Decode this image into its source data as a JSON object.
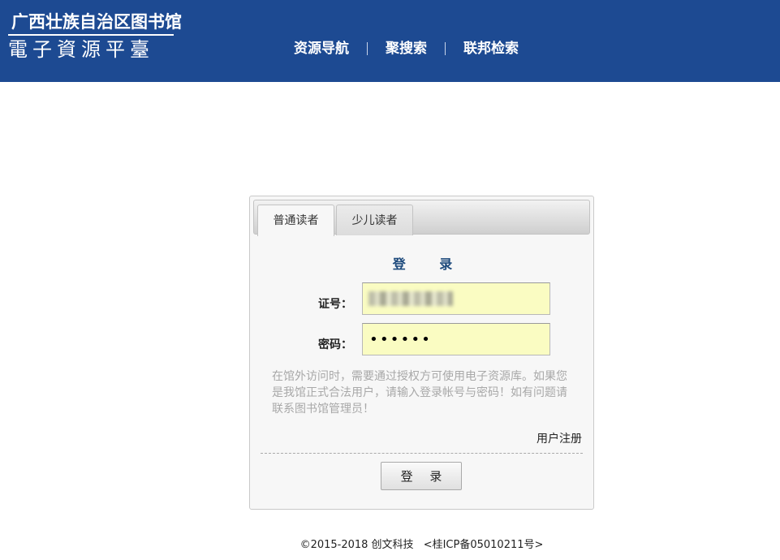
{
  "header": {
    "logo_line1": "广西壮族自治区图书馆",
    "logo_line2": "電子資源平臺",
    "nav": [
      "资源导航",
      "聚搜索",
      "联邦检索"
    ]
  },
  "login": {
    "tabs": [
      "普通读者",
      "少儿读者"
    ],
    "active_tab": 0,
    "title": "登 录",
    "card_label": "证号：",
    "card_value": "",
    "password_label": "密码：",
    "password_value": "••••••",
    "notice": "在馆外访问时，需要通过授权方可使用电子资源库。如果您是我馆正式合法用户，请输入登录帐号与密码！如有问题请联系图书馆管理员！",
    "register_link": "用户注册",
    "submit_label": "登 录"
  },
  "footer": {
    "copyright": "©2015-2018 创文科技",
    "icp": "<桂ICP备05010211号>"
  },
  "colors": {
    "header_bg": "#1d4a92",
    "input_bg": "#fafcc2",
    "title": "#1d4a7c"
  }
}
